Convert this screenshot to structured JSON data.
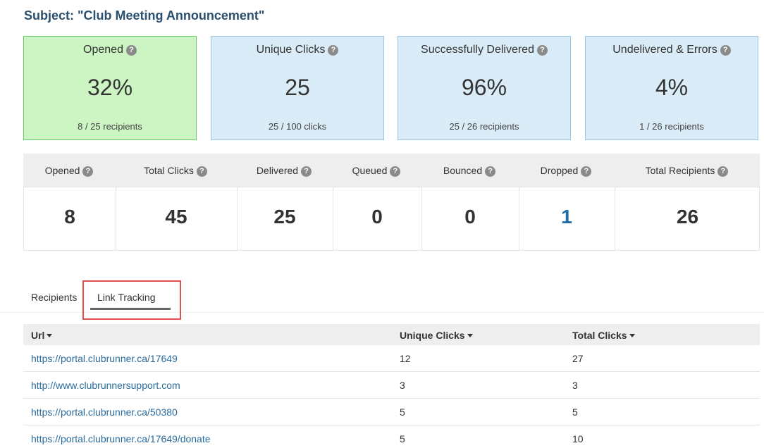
{
  "subject": "Subject: \"Club Meeting Announcement\"",
  "cards": [
    {
      "title": "Opened",
      "value": "32%",
      "sub": "8 / 25 recipients"
    },
    {
      "title": "Unique Clicks",
      "value": "25",
      "sub": "25 / 100 clicks"
    },
    {
      "title": "Successfully Delivered",
      "value": "96%",
      "sub": "25 / 26 recipients"
    },
    {
      "title": "Undelivered & Errors",
      "value": "4%",
      "sub": "1 / 26 recipients"
    }
  ],
  "stats": [
    {
      "label": "Opened",
      "value": "8"
    },
    {
      "label": "Total Clicks",
      "value": "45"
    },
    {
      "label": "Delivered",
      "value": "25"
    },
    {
      "label": "Queued",
      "value": "0"
    },
    {
      "label": "Bounced",
      "value": "0"
    },
    {
      "label": "Dropped",
      "value": "1"
    },
    {
      "label": "Total Recipients",
      "value": "26"
    }
  ],
  "help_icon": "question-circle-icon",
  "help_glyph": "?",
  "tabs": {
    "recipients": "Recipients",
    "link_tracking": "Link Tracking"
  },
  "table": {
    "headers": [
      "Url",
      "Unique Clicks",
      "Total Clicks"
    ],
    "rows": [
      [
        "https://portal.clubrunner.ca/17649",
        "12",
        "27"
      ],
      [
        "http://www.clubrunnersupport.com",
        "3",
        "3"
      ],
      [
        "https://portal.clubrunner.ca/50380",
        "5",
        "5"
      ],
      [
        "https://portal.clubrunner.ca/17649/donate",
        "5",
        "10"
      ]
    ]
  },
  "colors": {
    "opened_card_bg": "#cdf5c3",
    "card_bg": "#d9ecf7",
    "link": "#2a6b9c",
    "dropped_value": "#1e6fa8",
    "highlight": "#e05050"
  }
}
